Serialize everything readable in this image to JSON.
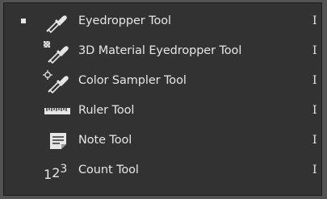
{
  "flyout": {
    "selected_index": 0,
    "items": [
      {
        "label": "Eyedropper Tool",
        "shortcut": "I",
        "icon": "eyedropper-icon"
      },
      {
        "label": "3D Material Eyedropper Tool",
        "shortcut": "I",
        "icon": "3d-material-eyedropper-icon"
      },
      {
        "label": "Color Sampler Tool",
        "shortcut": "I",
        "icon": "color-sampler-icon"
      },
      {
        "label": "Ruler Tool",
        "shortcut": "I",
        "icon": "ruler-icon"
      },
      {
        "label": "Note Tool",
        "shortcut": "I",
        "icon": "note-icon"
      },
      {
        "label": "Count Tool",
        "shortcut": "I",
        "icon": "count-icon",
        "icon_text": "123"
      }
    ]
  },
  "colors": {
    "menu_background": "#323232",
    "outer_background": "#535353",
    "text": "#e6e6e6"
  }
}
